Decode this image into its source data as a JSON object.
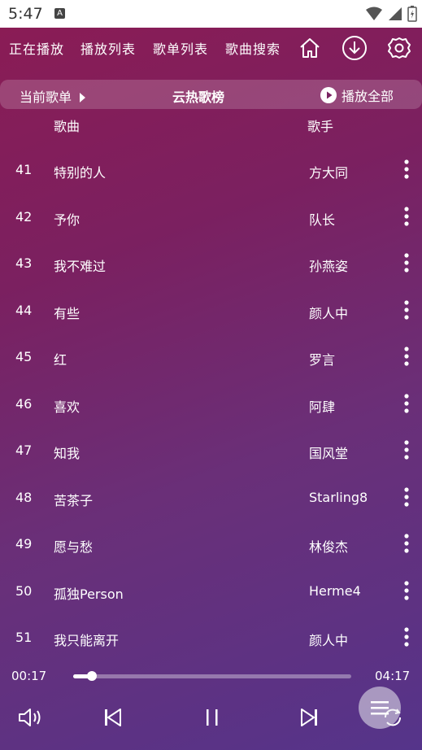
{
  "status_bar": {
    "time": "5:47",
    "notification_icon": "A"
  },
  "nav": {
    "tabs": [
      "正在播放",
      "播放列表",
      "歌单列表",
      "歌曲搜索"
    ],
    "icons": [
      "home-icon",
      "download-icon",
      "settings-icon"
    ]
  },
  "songlist": {
    "current_label": "当前歌单",
    "title": "云热歌榜",
    "play_all_label": "播放全部"
  },
  "columns": {
    "song": "歌曲",
    "artist": "歌手"
  },
  "songs": [
    {
      "num": "41",
      "title": "特别的人",
      "artist": "方大同"
    },
    {
      "num": "42",
      "title": "予你",
      "artist": "队长"
    },
    {
      "num": "43",
      "title": "我不难过",
      "artist": "孙燕姿"
    },
    {
      "num": "44",
      "title": "有些",
      "artist": "颜人中"
    },
    {
      "num": "45",
      "title": "红",
      "artist": "罗言"
    },
    {
      "num": "46",
      "title": "喜欢",
      "artist": "阿肆"
    },
    {
      "num": "47",
      "title": "知我",
      "artist": "国风堂"
    },
    {
      "num": "48",
      "title": "苦茶子",
      "artist": "Starling8"
    },
    {
      "num": "49",
      "title": "愿与愁",
      "artist": "林俊杰"
    },
    {
      "num": "50",
      "title": "孤独Person",
      "artist": "Herme4"
    },
    {
      "num": "51",
      "title": "我只能离开",
      "artist": "颜人中"
    }
  ],
  "player": {
    "elapsed": "00:17",
    "duration": "04:17",
    "progress_fraction": 0.066
  },
  "colors": {
    "accent": "#8a1c55",
    "text": "#ffffff"
  }
}
